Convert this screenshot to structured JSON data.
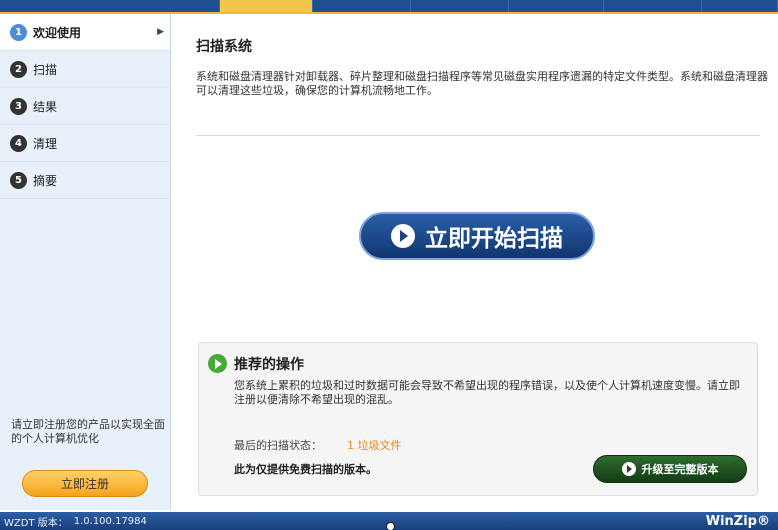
{
  "sidebar": {
    "steps": [
      {
        "num": "1",
        "label": "欢迎使用"
      },
      {
        "num": "2",
        "label": "扫描"
      },
      {
        "num": "3",
        "label": "结果"
      },
      {
        "num": "4",
        "label": "清理"
      },
      {
        "num": "5",
        "label": "摘要"
      }
    ],
    "register_note": "请立即注册您的产品以实现全面的个人计算机优化",
    "register_button": "立即注册"
  },
  "main": {
    "title": "扫描系统",
    "description": "系统和磁盘清理器针对卸载器、碎片整理和磁盘扫描程序等常见磁盘实用程序遗漏的特定文件类型。系统和磁盘清理器可以清理这些垃圾，确保您的计算机流畅地工作。",
    "scan_button": "立即开始扫描"
  },
  "recommend": {
    "title": "推荐的操作",
    "text": "您系统上累积的垃圾和过时数据可能会导致不希望出现的程序错误，以及使个人计算机速度变慢。请立即注册以便清除不希望出现的混乱。",
    "status_label": "最后的扫描状态：",
    "status_value": "1 垃圾文件",
    "free_note": "此为仅提供免费扫描的版本。",
    "upgrade_button": "升级至完整版本"
  },
  "footer": {
    "version_label": "WZDT 版本：",
    "version_value": "1.0.100.17984",
    "brand": "WinZip®"
  },
  "colors": {
    "accent": "#1e4f92",
    "register": "#f4a21b",
    "upgrade": "#2f6c2f",
    "status": "#e6891a"
  }
}
